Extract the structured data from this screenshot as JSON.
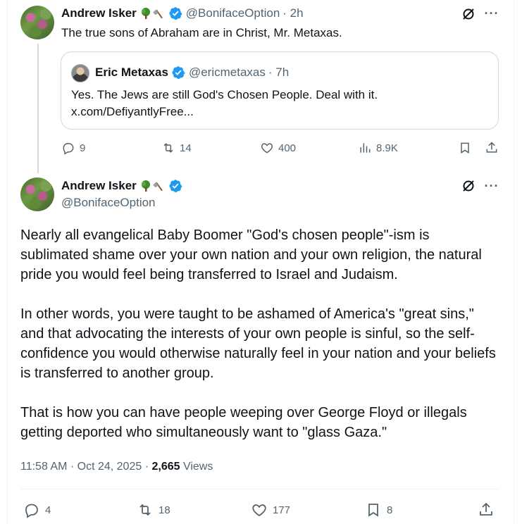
{
  "colors": {
    "verified": "#1d9bf0",
    "muted": "#536471",
    "text": "#0f1419",
    "border": "#cfd9de"
  },
  "reply_tweet": {
    "author": {
      "name": "Andrew Isker",
      "emoji": [
        "tree",
        "axe"
      ],
      "handle": "@BonifaceOption",
      "time": "· 2h"
    },
    "text": "The true sons of Abraham are in Christ, Mr. Metaxas.",
    "quoted": {
      "author": {
        "name": "Eric Metaxas",
        "handle": "@ericmetaxas",
        "time": "· 7h"
      },
      "text": "Yes. The Jews are still God's Chosen People. Deal with it.",
      "link": "x.com/DefiyantlyFree..."
    },
    "actions": {
      "replies": "9",
      "reposts": "14",
      "likes": "400",
      "views": "8.9K"
    }
  },
  "main_tweet": {
    "author": {
      "name": "Andrew Isker",
      "emoji": [
        "tree",
        "axe"
      ],
      "handle": "@BonifaceOption"
    },
    "paragraphs": [
      "Nearly all evangelical Baby Boomer \"God's chosen people\"-ism is sublimated shame over your own nation and your own religion, the natural pride you would feel being transferred to Israel and Judaism.",
      "In other words, you were taught to be ashamed of America's \"great sins,\" and that advocating the interests of your own people is sinful, so the self-confidence you would otherwise naturally feel in your nation and your beliefs is transferred to another group.",
      "That is how you can have people weeping over George Floyd or illegals getting deported who simultaneously want to \"glass Gaza.\""
    ],
    "meta": {
      "time": "11:58 AM · Oct 24, 2025 · ",
      "views_count": "2,665",
      "views_label": " Views"
    },
    "actions": {
      "replies": "4",
      "reposts": "18",
      "likes": "177",
      "bookmarks": "8"
    }
  },
  "icons": [
    "verified-icon",
    "grok-icon",
    "more-icon",
    "reply-icon",
    "repost-icon",
    "like-icon",
    "views-icon",
    "bookmark-icon",
    "share-icon"
  ]
}
